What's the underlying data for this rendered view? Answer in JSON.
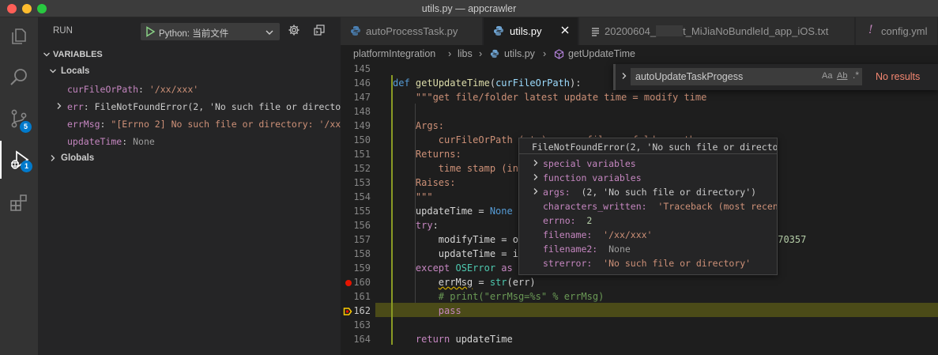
{
  "window": {
    "title": "utils.py — appcrawler"
  },
  "activity_bar": {
    "items": [
      {
        "icon": "explorer-icon"
      },
      {
        "icon": "search-icon"
      },
      {
        "icon": "source-control-icon",
        "badge": "5"
      },
      {
        "icon": "run-debug-icon",
        "badge": "1"
      },
      {
        "icon": "extensions-icon"
      }
    ]
  },
  "sidebar": {
    "run_label": "RUN",
    "launch_config": "Python: 当前文件",
    "variables_header": "VARIABLES",
    "locals_label": "Locals",
    "globals_label": "Globals",
    "locals": [
      {
        "name": "curFileOrPath",
        "value": "'/xx/xxx'",
        "kind": "str",
        "expandable": false
      },
      {
        "name": "err",
        "value": "FileNotFoundError(2, 'No such file or director…",
        "kind": "plain",
        "expandable": true
      },
      {
        "name": "errMsg",
        "value": "\"[Errno 2] No such file or directory: '/xx/…",
        "kind": "str",
        "expandable": false
      },
      {
        "name": "updateTime",
        "value": "None",
        "kind": "none",
        "expandable": false
      }
    ]
  },
  "tabs": [
    {
      "label": "autoProcessTask.py",
      "active": false
    },
    {
      "label": "utils.py",
      "active": true
    },
    {
      "label_prefix": "20200604_",
      "label_suffix": "t_MiJiaNoBundleId_app_iOS.txt",
      "active": false
    },
    {
      "label": "config.yml",
      "active": false
    }
  ],
  "breadcrumb": [
    "platformIntegration",
    "libs",
    "utils.py",
    "getUpdateTime"
  ],
  "find": {
    "query": "autoUpdateTaskProgess",
    "match_case": "Aa",
    "whole_word": "Ab",
    "regex": ".*",
    "result": "No results"
  },
  "code": {
    "line_numbers": [
      "145",
      "146",
      "147",
      "148",
      "149",
      "150",
      "151",
      "152",
      "153",
      "154",
      "155",
      "156",
      "157",
      "158",
      "159",
      "160",
      "161",
      "162",
      "163",
      "164"
    ],
    "breakpoint_line": "160",
    "current_line": "162",
    "visible_fragment": "270357"
  },
  "hover": {
    "title": "FileNotFoundError(2, 'No such file or directo…",
    "rows": [
      {
        "name": "special variables",
        "value": "",
        "expandable": true,
        "group": true
      },
      {
        "name": "function variables",
        "value": "",
        "expandable": true,
        "group": true
      },
      {
        "name": "args:",
        "value": "(2, 'No such file or directory')",
        "expandable": true,
        "kind": "plain"
      },
      {
        "name": "characters_written:",
        "value": "'Traceback (most recent",
        "expandable": false,
        "kind": "str"
      },
      {
        "name": "errno:",
        "value": "2",
        "expandable": false,
        "kind": "num"
      },
      {
        "name": "filename:",
        "value": "'/xx/xxx'",
        "expandable": false,
        "kind": "str"
      },
      {
        "name": "filename2:",
        "value": "None",
        "expandable": false,
        "kind": "none"
      },
      {
        "name": "strerror:",
        "value": "'No such file or directory'",
        "expandable": false,
        "kind": "str"
      }
    ]
  },
  "colors": {
    "accent": "#007acc",
    "breakpoint": "#e51400",
    "current_line": "#4b4b18",
    "no_results": "#f48771"
  }
}
